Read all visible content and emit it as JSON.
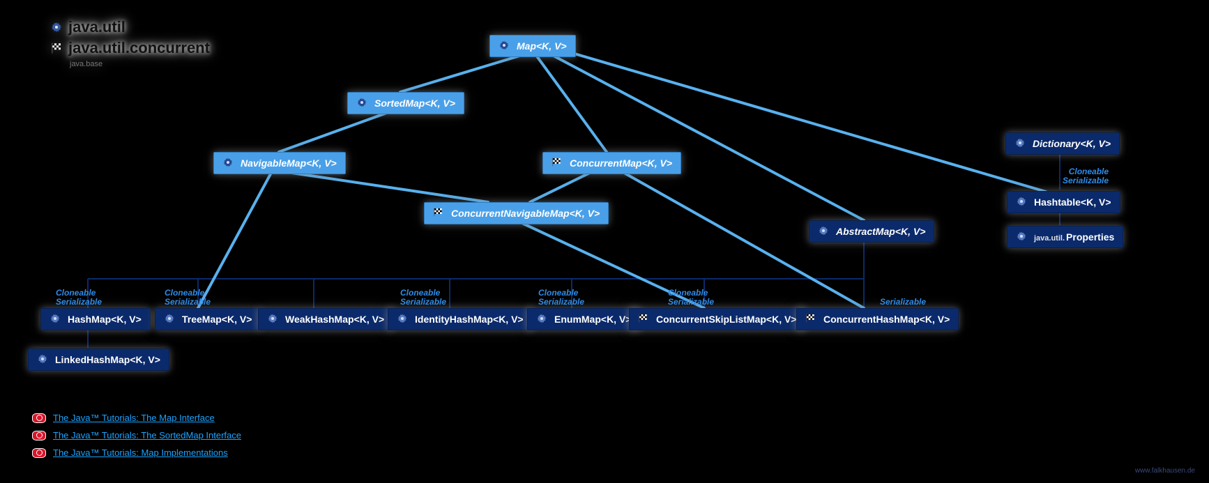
{
  "legend": {
    "util": "java.util",
    "concurrent": "java.util.concurrent",
    "module": "java.base"
  },
  "nodes": {
    "Map": {
      "label": "Map<K, V>"
    },
    "SortedMap": {
      "label": "SortedMap<K, V>"
    },
    "NavigableMap": {
      "label": "NavigableMap<K, V>"
    },
    "ConcurrentMap": {
      "label": "ConcurrentMap<K, V>"
    },
    "ConcurrentNavigableMap": {
      "label": "ConcurrentNavigableMap<K, V>"
    },
    "AbstractMap": {
      "label": "AbstractMap<K, V>"
    },
    "Dictionary": {
      "label": "Dictionary<K, V>"
    },
    "Hashtable": {
      "label": "Hashtable<K, V>"
    },
    "PropertiesPrefix": {
      "label": "java.util."
    },
    "Properties": {
      "label": "Properties"
    },
    "HashMap": {
      "label": "HashMap<K, V>"
    },
    "LinkedHashMap": {
      "label": "LinkedHashMap<K, V>"
    },
    "TreeMap": {
      "label": "TreeMap<K, V>"
    },
    "WeakHashMap": {
      "label": "WeakHashMap<K, V>"
    },
    "IdentityHashMap": {
      "label": "IdentityHashMap<K, V>"
    },
    "EnumMap": {
      "label": "EnumMap<K, V>"
    },
    "ConcurrentSkipListMap": {
      "label": "ConcurrentSkipListMap<K, V>"
    },
    "ConcurrentHashMap": {
      "label": "ConcurrentHashMap<K, V>"
    }
  },
  "annotations": {
    "cloneable": "Cloneable",
    "serializable": "Serializable"
  },
  "links": {
    "map": "The Java™ Tutorials: The Map Interface",
    "sorted": "The Java™ Tutorials: The SortedMap Interface",
    "impl": "The Java™ Tutorials: Map Implementations"
  },
  "credit": "www.falkhausen.de"
}
